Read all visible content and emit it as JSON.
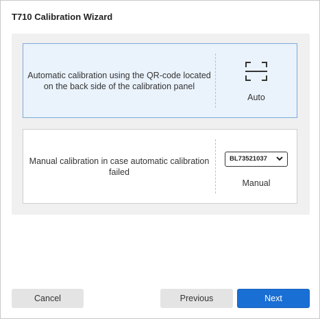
{
  "window": {
    "title": "T710 Calibration Wizard"
  },
  "options": {
    "auto": {
      "description": "Automatic calibration using the QR-code located on the back side of the calibration panel",
      "label": "Auto",
      "icon": "qr-scan-icon",
      "selected": true
    },
    "manual": {
      "description": "Manual calibration in case automatic calibration failed",
      "label": "Manual",
      "serial_select": {
        "selected_value": "BL73521037"
      },
      "icon": "chevron-down-icon",
      "selected": false
    }
  },
  "buttons": {
    "cancel": "Cancel",
    "previous": "Previous",
    "next": "Next"
  },
  "colors": {
    "accent": "#1a6fd4",
    "selected_bg": "#eaf3fc",
    "selected_border": "#7aa7d8"
  }
}
